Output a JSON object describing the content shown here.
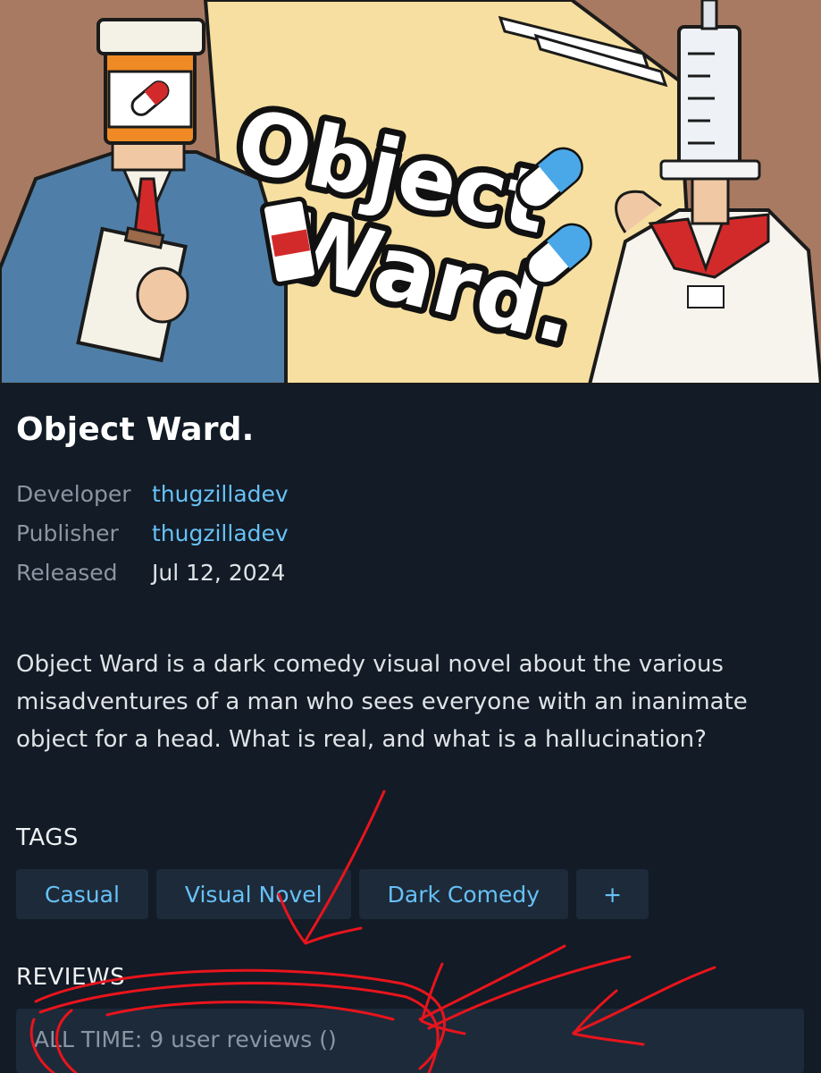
{
  "hero": {
    "logo_text_line1": "Object",
    "logo_text_line2": "Ward."
  },
  "game": {
    "title": "Object Ward.",
    "meta": [
      {
        "key": "Developer",
        "value": "thugzilladev",
        "link": true
      },
      {
        "key": "Publisher",
        "value": "thugzilladev",
        "link": true
      },
      {
        "key": "Released",
        "value": "Jul 12, 2024",
        "link": false
      }
    ],
    "description": "Object Ward is a dark comedy visual novel about the various misadventures of a man who sees everyone with an inanimate object for a head. What is real, and what is a hallucination?"
  },
  "tags": {
    "heading": "TAGS",
    "items": [
      "Casual",
      "Visual Novel",
      "Dark Comedy",
      "+"
    ]
  },
  "reviews": {
    "heading": "REVIEWS",
    "summary": "ALL TIME: 9 user reviews ()"
  },
  "colors": {
    "background": "#121b26",
    "panel": "#1d2a3a",
    "link": "#67c1f5",
    "muted": "#8b96a2",
    "annotation": "#e8141c"
  }
}
